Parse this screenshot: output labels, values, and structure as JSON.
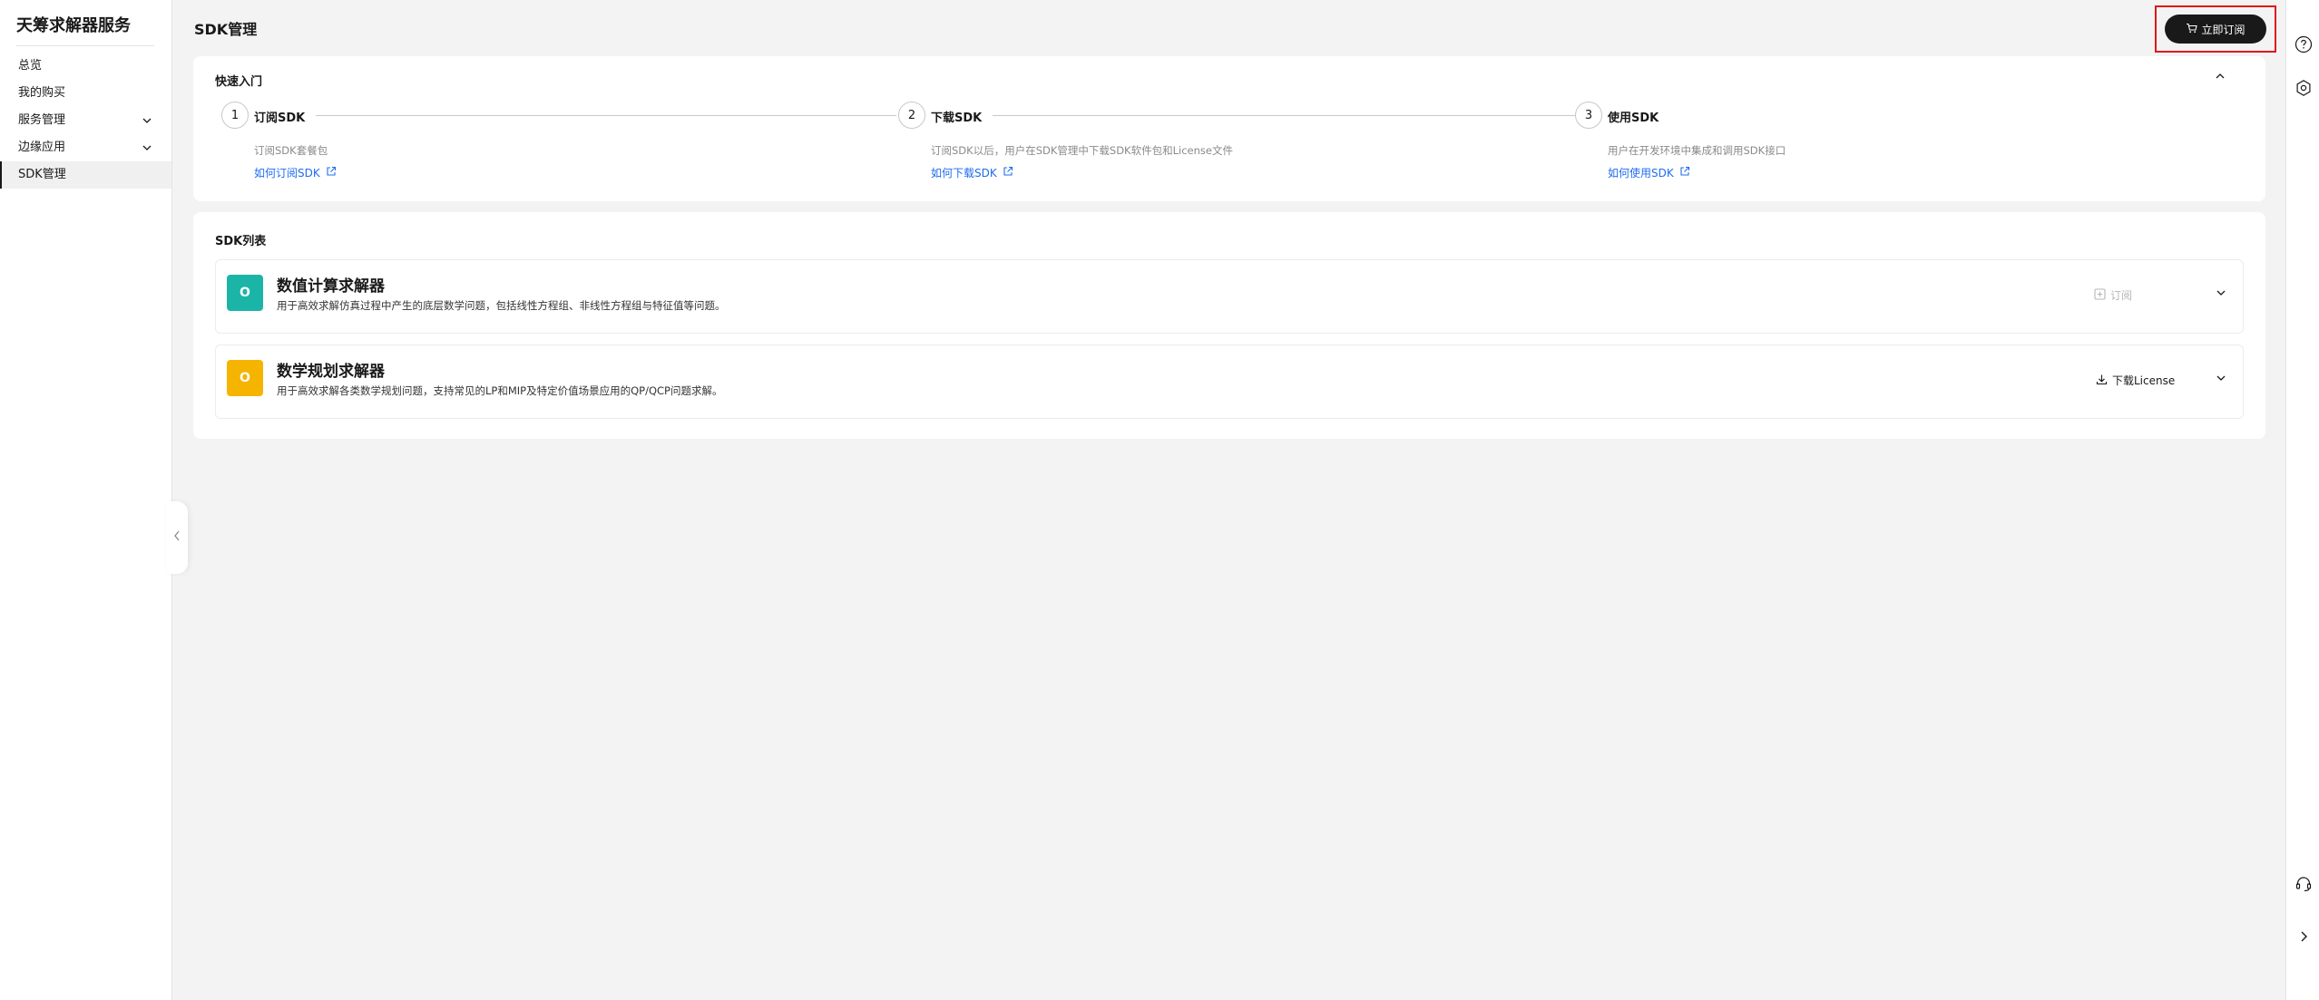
{
  "sidebar": {
    "title": "天筹求解器服务",
    "items": [
      {
        "label": "总览"
      },
      {
        "label": "我的购买"
      },
      {
        "label": "服务管理"
      },
      {
        "label": "边缘应用"
      },
      {
        "label": "SDK管理"
      }
    ]
  },
  "header": {
    "title": "SDK管理",
    "subscribe_label": "立即订阅"
  },
  "quick_start": {
    "title": "快速入门",
    "steps": [
      {
        "num": "1",
        "name": "订阅SDK",
        "desc": "订阅SDK套餐包",
        "link": "如何订阅SDK"
      },
      {
        "num": "2",
        "name": "下载SDK",
        "desc": "订阅SDK以后，用户在SDK管理中下载SDK软件包和License文件",
        "link": "如何下载SDK"
      },
      {
        "num": "3",
        "name": "使用SDK",
        "desc": "用户在开发环境中集成和调用SDK接口",
        "link": "如何使用SDK"
      }
    ]
  },
  "sdk_list": {
    "title": "SDK列表",
    "items": [
      {
        "logo_text": "O",
        "logo_color": "#1bb5a8",
        "name": "数值计算求解器",
        "desc": "用于高效求解仿真过程中产生的底层数学问题，包括线性方程组、非线性方程组与特征值等问题。",
        "action_label": "订阅",
        "action_icon": "subscribe-plus-icon"
      },
      {
        "logo_text": "O",
        "logo_color": "#f5b400",
        "name": "数学规划求解器",
        "desc": "用于高效求解各类数学规划问题，支持常见的LP和MIP及特定价值场景应用的QP/QCP问题求解。",
        "action_label": "下载License",
        "action_icon": "download-icon"
      }
    ]
  },
  "colors": {
    "accent_link": "#1f6df0",
    "primary_button": "#191919",
    "highlight_border": "#e0181a"
  }
}
